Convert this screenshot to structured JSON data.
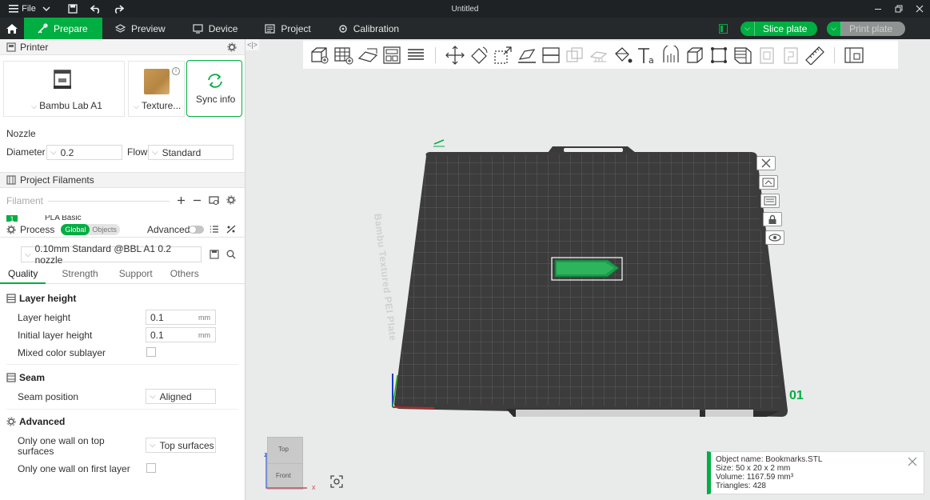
{
  "titlebar": {
    "menu_label": "File",
    "title": "Untitled"
  },
  "nav": {
    "tabs": [
      {
        "label": "Prepare",
        "active": true
      },
      {
        "label": "Preview"
      },
      {
        "label": "Device"
      },
      {
        "label": "Project"
      },
      {
        "label": "Calibration"
      }
    ],
    "slice_label": "Slice plate",
    "print_label": "Print plate"
  },
  "printer": {
    "section_title": "Printer",
    "printer_name": "Bambu Lab A1",
    "plate_name": "Texture...",
    "sync_label": "Sync info",
    "nozzle_label": "Nozzle",
    "diameter_label": "Diameter",
    "diameter_value": "0.2",
    "flow_label": "Flow",
    "flow_value": "Standard"
  },
  "filaments": {
    "section_title": "Project Filaments",
    "filament_label": "Filament",
    "first_index": "1",
    "first_name": "PLA Basic"
  },
  "process": {
    "section_title": "Process",
    "global_label": "Global",
    "objects_label": "Objects",
    "advanced_label": "Advanced",
    "preset": "0.10mm Standard @BBL A1 0.2 nozzle",
    "tabs": [
      "Quality",
      "Strength",
      "Support",
      "Others"
    ],
    "layer_height_group": "Layer height",
    "layer_height_label": "Layer height",
    "layer_height_value": "0.1",
    "initial_layer_label": "Initial layer height",
    "initial_layer_value": "0.1",
    "unit_mm": "mm",
    "mixed_color_label": "Mixed color sublayer",
    "seam_group": "Seam",
    "seam_position_label": "Seam position",
    "seam_position_value": "Aligned",
    "advanced_group": "Advanced",
    "one_wall_top_label_1": "Only one wall on top",
    "one_wall_top_label_2": "surfaces",
    "one_wall_top_value": "Top surfaces",
    "one_wall_first_label": "Only one wall on first layer"
  },
  "viewport": {
    "plate_text": "Bambu Textured PEI Plate",
    "plate_number": "01",
    "view_top": "Top",
    "view_front": "Front",
    "axis_x": "x",
    "axis_z": "z"
  },
  "object_info": {
    "name": "Object name: Bookmarks.STL",
    "size": "Size: 50 x 20 x 2 mm",
    "volume": "Volume: 1167.59 mm³",
    "triangles": "Triangles: 428"
  },
  "colors": {
    "accent": "#00ae42",
    "titlebar": "#1e2224",
    "navbar": "#25292b",
    "bed": "#3c3c3c"
  }
}
